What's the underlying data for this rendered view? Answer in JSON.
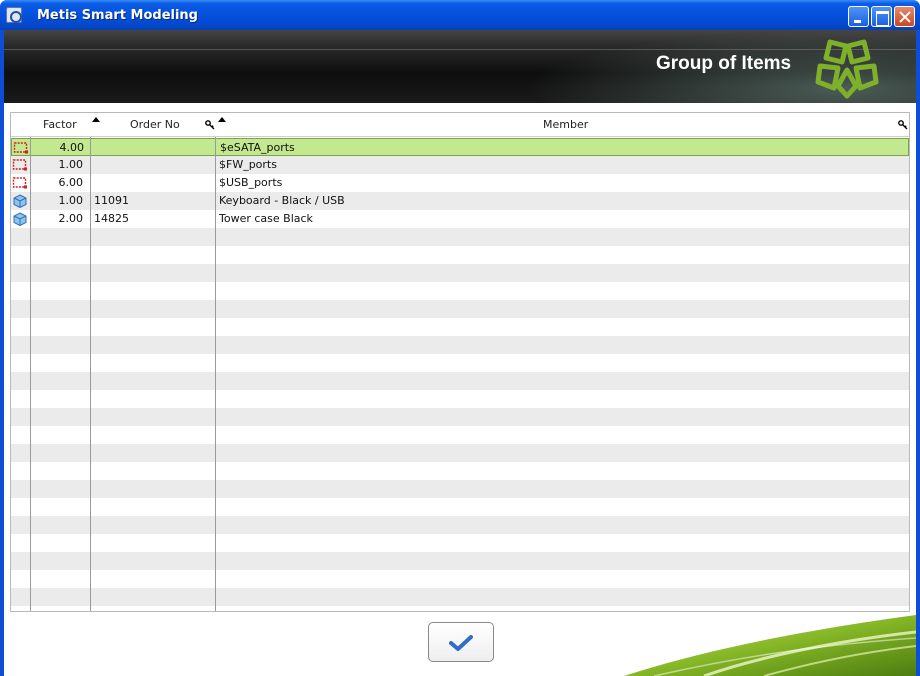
{
  "window": {
    "title": "Metis Smart Modeling"
  },
  "banner": {
    "title": "Group of Items"
  },
  "table": {
    "columns": [
      {
        "key": "factor",
        "label": "Factor"
      },
      {
        "key": "order_no",
        "label": "Order No"
      },
      {
        "key": "member",
        "label": "Member"
      }
    ],
    "rows": [
      {
        "icon": "group-icon",
        "factor": "4.00",
        "order_no": "",
        "member": "$eSATA_ports",
        "selected": true
      },
      {
        "icon": "group-icon",
        "factor": "1.00",
        "order_no": "",
        "member": "$FW_ports",
        "selected": false
      },
      {
        "icon": "group-icon",
        "factor": "6.00",
        "order_no": "",
        "member": "$USB_ports",
        "selected": false
      },
      {
        "icon": "item-cube-icon",
        "factor": "1.00",
        "order_no": "11091",
        "member": "Keyboard - Black / USB",
        "selected": false
      },
      {
        "icon": "item-cube-icon",
        "factor": "2.00",
        "order_no": "14825",
        "member": "Tower case Black",
        "selected": false
      }
    ]
  },
  "colors": {
    "selected_row": "#c2e98f",
    "alt_row": "#ebebeb",
    "accent_green": "#8bbf2a",
    "titlebar_blue": "#0551dc"
  }
}
